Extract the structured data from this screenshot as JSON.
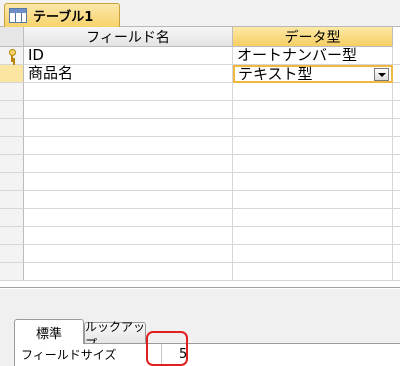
{
  "document_tab": {
    "label": "テーブル1",
    "icon": "table-icon"
  },
  "grid": {
    "headers": {
      "field_name": "フィールド名",
      "data_type": "データ型"
    },
    "rows": [
      {
        "field": "ID",
        "type": "オートナンバー型",
        "primary_key": true
      },
      {
        "field": "商品名",
        "type": "テキスト型",
        "current": true
      }
    ]
  },
  "properties": {
    "tabs": {
      "standard": "標準",
      "lookup": "ルックアップ"
    },
    "field_size": {
      "label": "フィールドサイズ",
      "value": "5"
    }
  },
  "colors": {
    "active_header": "#f6cf63",
    "highlight": "#e02020"
  }
}
